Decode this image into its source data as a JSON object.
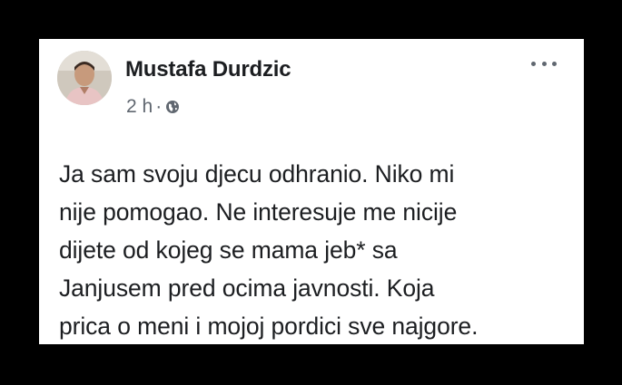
{
  "post": {
    "author": "Mustafa Durdzic",
    "time": "2 h",
    "separator": "·",
    "privacy_icon": "globe-icon",
    "more_icon": "more-options-icon",
    "text": "Ja sam svoju djecu odhranio. Niko mi\nnije pomogao. Ne interesuje me nicije\ndijete od kojeg se mama jeb* sa\nJanjusem pred ocima javnosti. Koja\nprica o meni i mojoj pordici sve najgore."
  },
  "colors": {
    "background": "#000000",
    "card": "#ffffff",
    "text": "#1c1e21",
    "meta": "#606770"
  }
}
